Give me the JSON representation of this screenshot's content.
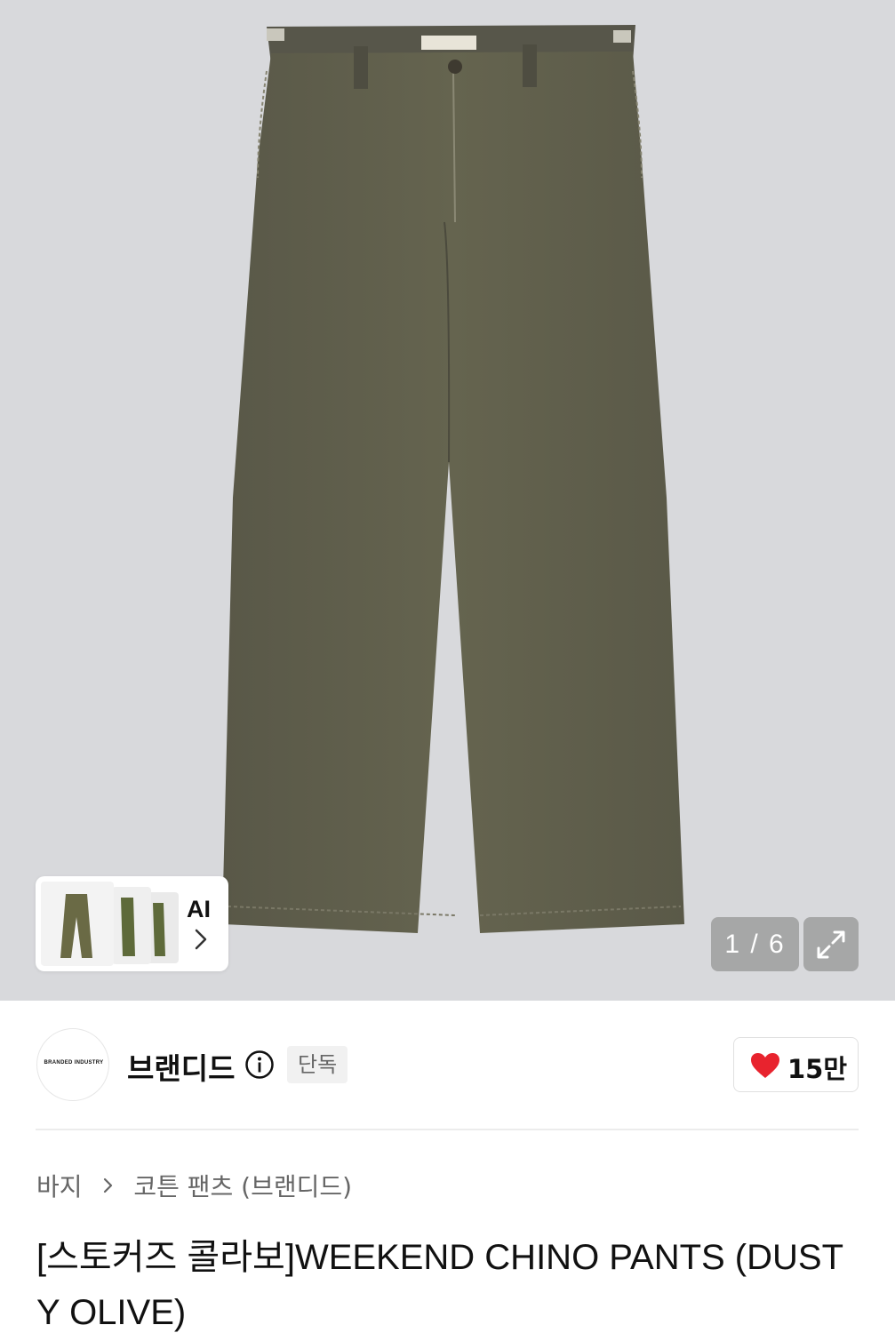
{
  "gallery": {
    "ai_label": "AI",
    "counter": "1 / 6",
    "icons": {
      "ai_chevron": "chevron-right-icon",
      "expand": "expand-icon"
    }
  },
  "brand": {
    "name": "브랜디드",
    "logo_text": "BRANDED INDUSTRY",
    "badge": "단독",
    "likes": "15만",
    "like_color": "#e8232e"
  },
  "breadcrumb": {
    "items": [
      "바지",
      "코튼 팬츠 (브랜디드)"
    ]
  },
  "product": {
    "title": "[스토커즈 콜라보]WEEKEND CHINO PANTS (DUSTY OLIVE)"
  },
  "colors": {
    "background": "#d8d9dc",
    "pants": "#5f5e4f"
  }
}
